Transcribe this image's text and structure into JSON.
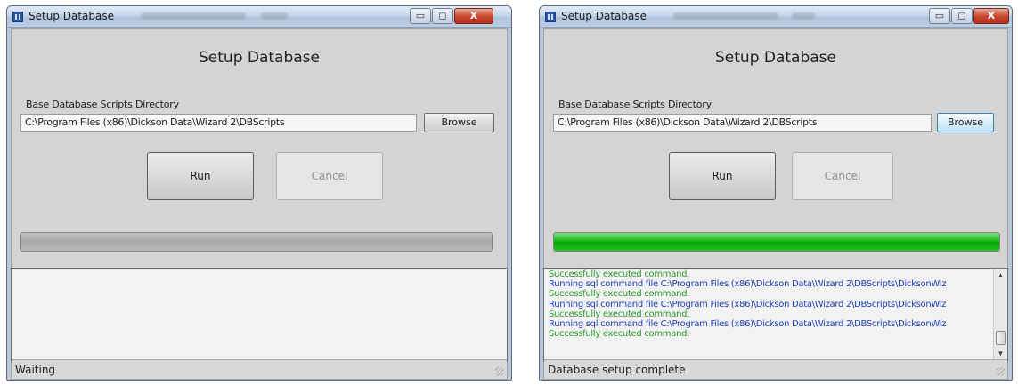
{
  "left": {
    "window_title": "Setup Database",
    "controls": {
      "minimize": "▭",
      "maximize": "◻",
      "close": "X"
    },
    "heading": "Setup Database",
    "dir_label": "Base Database Scripts Directory",
    "path_value": "C:\\Program Files (x86)\\Dickson Data\\Wizard 2\\DBScripts",
    "browse_label": "Browse",
    "run_label": "Run",
    "cancel_label": "Cancel",
    "progress_fraction": 0,
    "log_lines": [],
    "status": "Waiting"
  },
  "right": {
    "window_title": "Setup Database",
    "controls": {
      "minimize": "▭",
      "maximize": "◻",
      "close": "X"
    },
    "heading": "Setup Database",
    "dir_label": "Base Database Scripts Directory",
    "path_value": "C:\\Program Files (x86)\\Dickson Data\\Wizard 2\\DBScripts",
    "browse_label": "Browse",
    "run_label": "Run",
    "cancel_label": "Cancel",
    "progress_fraction": 1,
    "log_lines": [
      {
        "kind": "ok",
        "text": "Successfully executed command."
      },
      {
        "kind": "run",
        "text": "Running sql command file C:\\Program Files (x86)\\Dickson Data\\Wizard 2\\DBScripts\\DicksonWiz"
      },
      {
        "kind": "ok",
        "text": "Successfully executed command."
      },
      {
        "kind": "run",
        "text": "Running sql command file C:\\Program Files (x86)\\Dickson Data\\Wizard 2\\DBScripts\\DicksonWiz"
      },
      {
        "kind": "ok",
        "text": "Successfully executed command."
      },
      {
        "kind": "run",
        "text": "Running sql command file C:\\Program Files (x86)\\Dickson Data\\Wizard 2\\DBScripts\\DicksonWiz"
      },
      {
        "kind": "ok",
        "text": "Successfully executed command."
      }
    ],
    "status": "Database setup complete"
  },
  "icons": {
    "app": "app-grid-icon",
    "scroll_up": "▲",
    "scroll_down": "▼"
  }
}
